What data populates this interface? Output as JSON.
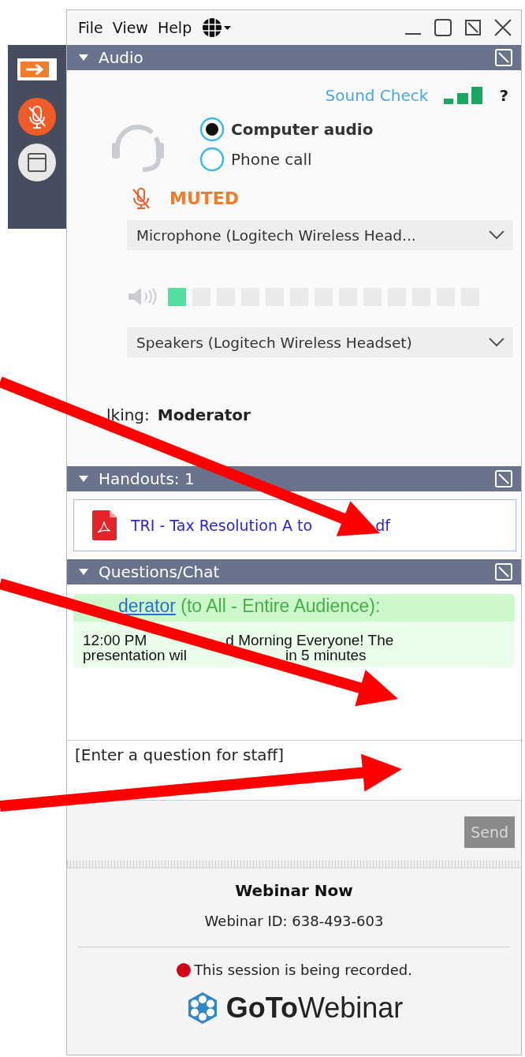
{
  "menu": [
    {
      "label": "File"
    },
    {
      "label": "View"
    },
    {
      "label": "Help"
    }
  ],
  "audio": {
    "title": "Audio",
    "sound_check": "Sound Check",
    "help": "?",
    "options": [
      {
        "label": "Computer audio",
        "selected": true
      },
      {
        "label": "Phone call",
        "selected": false
      }
    ],
    "mic_status": "MUTED",
    "microphone": "Microphone (Logitech  Wireless  Head...",
    "speaker_meter": {
      "level": 0.08
    },
    "speakers": "Speakers (Logitech Wireless Headset)",
    "talking_label": "lking:",
    "talking_name": "Moderator"
  },
  "handouts": {
    "title": "Handouts: 1",
    "files": [
      {
        "name_parts": [
          "TRI - Tax Resolution A to",
          "df"
        ]
      }
    ]
  },
  "chat": {
    "title": "Questions/Chat",
    "messages": [
      {
        "sender": "derator",
        "audience": "(to All - Entire Audience):",
        "lines": [
          [
            "12:00 PM",
            "d Morning Everyone! The"
          ],
          [
            "presentation wil",
            "in 5 minutes"
          ]
        ]
      }
    ],
    "input": {
      "placeholder": "[Enter a question for staff]"
    },
    "send": {
      "label": "Send",
      "disabled": true
    }
  },
  "footer": {
    "webinar_name": "Webinar Now",
    "webinar_id": "Webinar ID: 638-493-603",
    "recording": "This session is being recorded.",
    "logo_bold": "GoTo",
    "logo_light": "Webinar"
  }
}
